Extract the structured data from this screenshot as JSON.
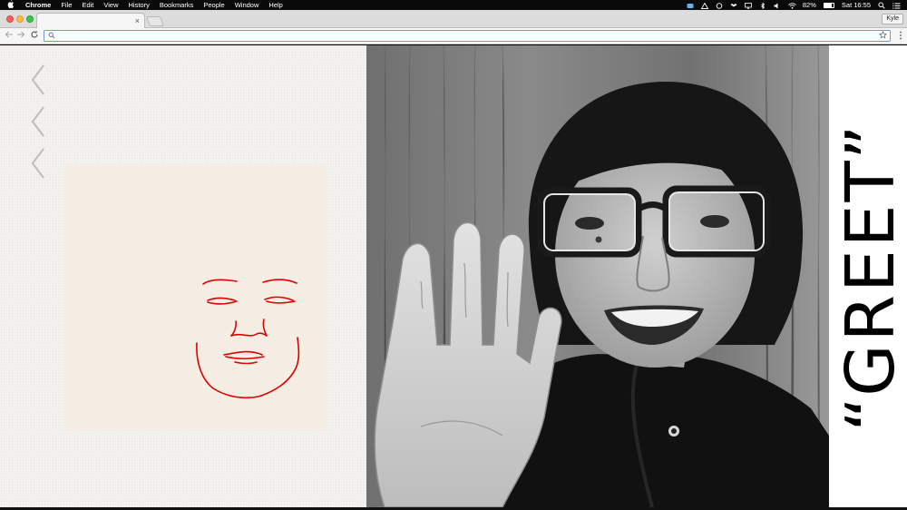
{
  "menubar": {
    "app_name": "Chrome",
    "menus": [
      "File",
      "Edit",
      "View",
      "History",
      "Bookmarks",
      "People",
      "Window",
      "Help"
    ],
    "battery_percent": 82,
    "battery_label": "82%",
    "clock": "Sat 16:55"
  },
  "browser": {
    "tab_close": "×",
    "profile_name": "Kyle",
    "address_value": "",
    "address_placeholder": ""
  },
  "page": {
    "word": "“GREET”"
  },
  "colors": {
    "menubar_bg": "#0a0a0a",
    "left_panel_bg": "#f3f1ee",
    "face_stroke": "#e00000",
    "chevron": "#b9b9b9",
    "word_color": "#000000"
  },
  "icons": {
    "apple": "apple-icon",
    "nav": [
      "back-arrow-icon",
      "forward-arrow-icon",
      "reload-icon"
    ],
    "omnibox": [
      "search-icon",
      "bookmark-star-icon"
    ],
    "chevrons": [
      "chevron-left-icon",
      "chevron-left-icon",
      "chevron-left-icon"
    ],
    "status": [
      "dropbox-icon",
      "drive-icon",
      "airplay-icon",
      "bluetooth-icon",
      "volume-icon",
      "wifi-icon",
      "battery-icon",
      "spotlight-icon",
      "notification-center-icon"
    ]
  }
}
